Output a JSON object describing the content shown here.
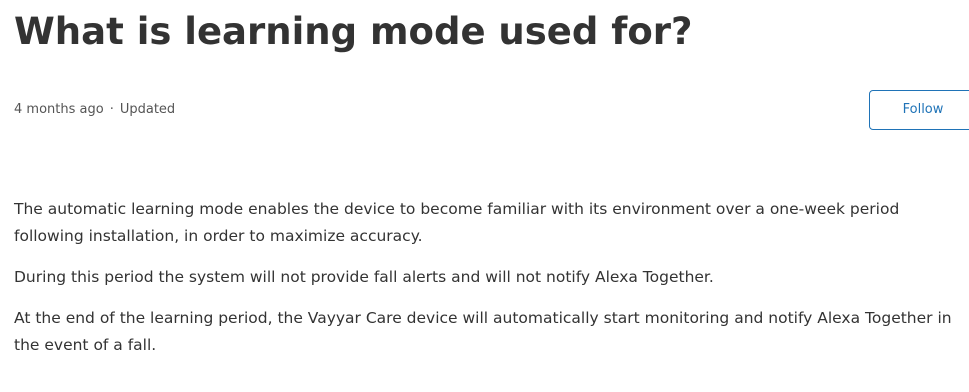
{
  "article": {
    "title": "What is learning mode used for?",
    "meta": {
      "posted": "4 months ago",
      "separator": "·",
      "status": "Updated"
    },
    "follow_label": "Follow",
    "paragraphs": [
      "The automatic learning mode enables the device to become familiar with its environment over a one-week period following installation, in order to maximize accuracy.",
      "During this period the system will not provide fall alerts and will not notify Alexa Together.",
      "At the end of the learning period, the Vayyar Care device will automatically start monitoring and notify Alexa Together in the event of a fall."
    ]
  },
  "colors": {
    "text": "#333333",
    "accent": "#1f73b7",
    "meta": "#555555"
  }
}
